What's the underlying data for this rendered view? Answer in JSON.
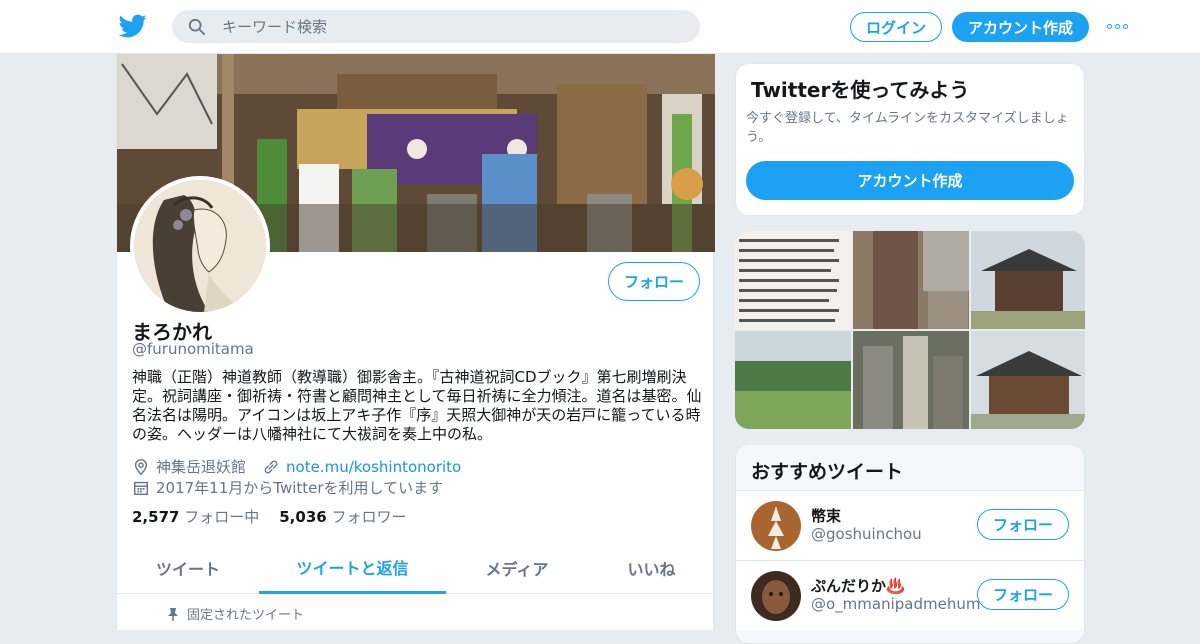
{
  "topbar": {
    "search_placeholder": "キーワード検索",
    "login_label": "ログイン",
    "signup_label": "アカウント作成"
  },
  "profile": {
    "name": "まろかれ",
    "handle": "@furunomitama",
    "follow_label": "フォロー",
    "bio": "神職（正階）神道教師（教導職）御影舎主。『古神道祝詞CDブック』第七刷増刷決定。祝詞講座・御祈祷・符書と顧問神主として毎日祈祷に全力傾注。道名は基密。仙名法名は陽明。アイコンは坂上アキ子作『序』天照大御神が天の岩戸に籠っている時の姿。ヘッダーは八幡神社にて大祓詞を奏上中の私。",
    "location": "神集岳退妖館",
    "website": "note.mu/koshintonorito",
    "joined": "2017年11月からTwitterを利用しています",
    "following_count": "2,577",
    "following_label": "フォロー中",
    "followers_count": "5,036",
    "followers_label": "フォロワー",
    "tabs": [
      {
        "label": "ツイート"
      },
      {
        "label": "ツイートと返信"
      },
      {
        "label": "メディア"
      },
      {
        "label": "いいね"
      }
    ],
    "active_tab": "ツイートと返信",
    "pinned_label": "固定されたツイート"
  },
  "signup_card": {
    "title": "Twitterを使ってみよう",
    "subtitle": "今すぐ登録して、タイムラインをカスタマイズしましょう。",
    "button_label": "アカウント作成"
  },
  "recommend": {
    "title": "おすすめツイート",
    "items": [
      {
        "name": "幣束",
        "handle": "@goshuinchou",
        "follow_label": "フォロー"
      },
      {
        "name": "ぷんだりか♨️",
        "handle": "@o_mmanipadmehum",
        "follow_label": "フォロー"
      }
    ]
  },
  "colors": {
    "accent": "#1da1f2",
    "background": "#e6ecf0",
    "secondary_text": "#657786"
  }
}
